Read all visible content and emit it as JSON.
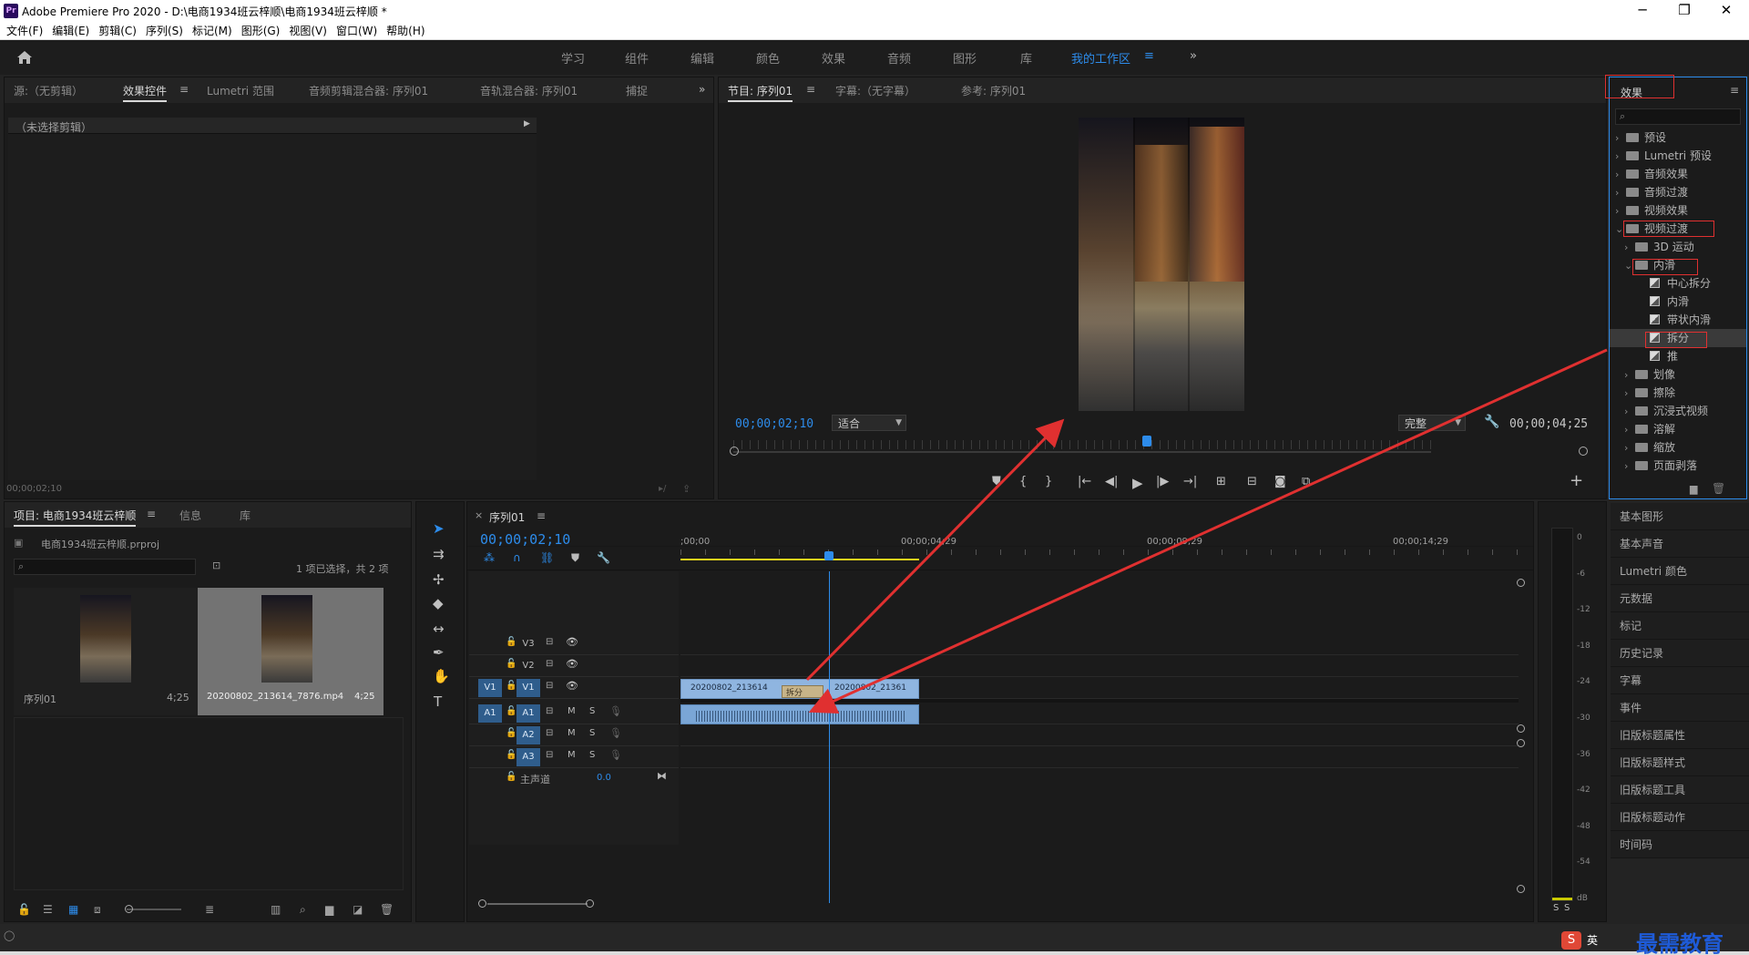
{
  "app": {
    "title": "Adobe Premiere Pro 2020 - D:\\电商1934班云梓顺\\电商1934班云梓顺 *",
    "icon_label": "Pr",
    "window_controls": [
      "─",
      "❐",
      "✕"
    ]
  },
  "menu": [
    "文件(F)",
    "编辑(E)",
    "剪辑(C)",
    "序列(S)",
    "标记(M)",
    "图形(G)",
    "视图(V)",
    "窗口(W)",
    "帮助(H)"
  ],
  "workspaces": {
    "items": [
      "学习",
      "组件",
      "编辑",
      "颜色",
      "效果",
      "音频",
      "图形",
      "库",
      "我的工作区"
    ],
    "active": "我的工作区",
    "menu_glyph": "≡",
    "more": "»"
  },
  "source_panel": {
    "tabs": [
      "源:（无剪辑）",
      "效果控件",
      "Lumetri 范围",
      "音频剪辑混合器: 序列01",
      "音轨混合器: 序列01",
      "捕捉"
    ],
    "active_tab": "效果控件",
    "menu_glyph": "≡",
    "more": "»",
    "no_clip": "（未选择剪辑）",
    "timecode": "00;00;02;10"
  },
  "program_panel": {
    "tabs": [
      "节目: 序列01",
      "字幕:（无字幕）",
      "参考: 序列01"
    ],
    "active_tab": "节目: 序列01",
    "menu_glyph": "≡",
    "timecode": "00;00;02;10",
    "fit": "适合",
    "quality": "完整",
    "duration": "00;00;04;25",
    "add": "+"
  },
  "effects_panel": {
    "title": "效果",
    "menu_glyph": "≡",
    "tree": [
      {
        "label": "预设",
        "level": 0,
        "kind": "folder"
      },
      {
        "label": "Lumetri 预设",
        "level": 0,
        "kind": "folder"
      },
      {
        "label": "音频效果",
        "level": 0,
        "kind": "folder"
      },
      {
        "label": "音频过渡",
        "level": 0,
        "kind": "folder"
      },
      {
        "label": "视频效果",
        "level": 0,
        "kind": "folder"
      },
      {
        "label": "视频过渡",
        "level": 0,
        "kind": "folder",
        "open": true
      },
      {
        "label": "3D 运动",
        "level": 1,
        "kind": "folder"
      },
      {
        "label": "内滑",
        "level": 1,
        "kind": "folder",
        "open": true
      },
      {
        "label": "中心拆分",
        "level": 2,
        "kind": "fx"
      },
      {
        "label": "内滑",
        "level": 2,
        "kind": "fx"
      },
      {
        "label": "带状内滑",
        "level": 2,
        "kind": "fx"
      },
      {
        "label": "拆分",
        "level": 2,
        "kind": "fx",
        "selected": true
      },
      {
        "label": "推",
        "level": 2,
        "kind": "fx"
      },
      {
        "label": "划像",
        "level": 1,
        "kind": "folder"
      },
      {
        "label": "擦除",
        "level": 1,
        "kind": "folder"
      },
      {
        "label": "沉浸式视频",
        "level": 1,
        "kind": "folder"
      },
      {
        "label": "溶解",
        "level": 1,
        "kind": "folder"
      },
      {
        "label": "缩放",
        "level": 1,
        "kind": "folder"
      },
      {
        "label": "页面剥落",
        "level": 1,
        "kind": "folder"
      }
    ]
  },
  "right_panels": [
    "基本图形",
    "基本声音",
    "Lumetri 颜色",
    "元数据",
    "标记",
    "历史记录",
    "字幕",
    "事件",
    "旧版标题属性",
    "旧版标题样式",
    "旧版标题工具",
    "旧版标题动作",
    "时间码"
  ],
  "project_panel": {
    "tabs": [
      "项目: 电商1934班云梓顺",
      "信息",
      "库"
    ],
    "active_tab": "项目: 电商1934班云梓顺",
    "menu_glyph": "≡",
    "file": "电商1934班云梓顺.prproj",
    "selection": "1 项已选择，共 2 项",
    "items": [
      {
        "name": "序列01",
        "duration": "4;25"
      },
      {
        "name": "20200802_213614_7876.mp4",
        "duration": "4;25"
      }
    ]
  },
  "timeline": {
    "tab": "序列01",
    "close": "×",
    "menu_glyph": "≡",
    "timecode": "00;00;02;10",
    "ruler": [
      ";00;00",
      "00;00;04;29",
      "00;00;09;29",
      "00;00;14;29"
    ],
    "video_tracks": [
      {
        "name": "V3"
      },
      {
        "name": "V2"
      },
      {
        "name": "V1",
        "src": "V1"
      }
    ],
    "audio_tracks": [
      {
        "name": "A1",
        "src": "A1"
      },
      {
        "name": "A2"
      },
      {
        "name": "A3"
      }
    ],
    "master": "主声道",
    "master_value": "0.0",
    "mute": "M",
    "solo": "S",
    "clips": {
      "left": "20200802_213614",
      "right": "20200802_21361",
      "transition": "拆分"
    },
    "playhead_fraction": 0.115
  },
  "meter": {
    "scale": [
      "0",
      "-6",
      "-12",
      "-18",
      "-24",
      "-30",
      "-36",
      "-42",
      "-48",
      "-54",
      "dB"
    ],
    "solo": [
      "S",
      "S"
    ]
  },
  "ime": {
    "label": "英",
    "watermark": "最需教育"
  },
  "colors": {
    "accent": "#2d8ceb",
    "clip_video": "#8fb5e0",
    "clip_audio": "#7aa6d6",
    "annotation": "#e03030",
    "track_target": "#2f5d8c"
  }
}
